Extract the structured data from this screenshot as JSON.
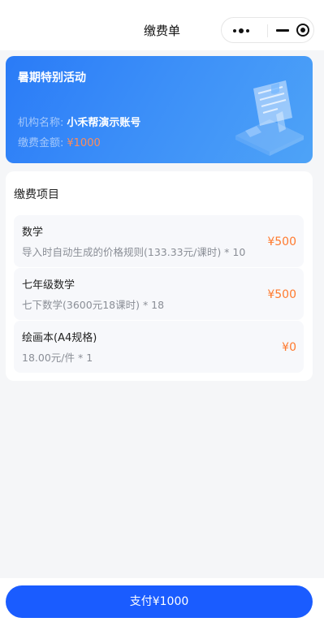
{
  "navbar": {
    "title": "缴费单",
    "more_icon": "more-dots-icon",
    "minimize_icon": "minimize-icon",
    "close_icon": "target-circle-icon"
  },
  "banner": {
    "title": "暑期特别活动",
    "org_label": "机构名称:",
    "org_value": "小禾帮演示账号",
    "amount_label": "缴费金额:",
    "amount_value": "¥1000",
    "illustration_icon": "bill-document-illustration"
  },
  "items_card": {
    "title": "缴费项目",
    "items": [
      {
        "name": "数学",
        "desc": "导入时自动生成的价格规则(133.33元/课时) * 10",
        "price": "¥500"
      },
      {
        "name": "七年级数学",
        "desc": "七下数学(3600元18课时) * 18",
        "price": "¥500"
      },
      {
        "name": "绘画本(A4规格)",
        "desc": "18.00元/件 * 1",
        "price": "¥0"
      }
    ]
  },
  "footer": {
    "pay_label": "支付¥1000"
  },
  "colors": {
    "primary": "#1a5cff",
    "price": "#ff7a2e",
    "banner_start": "#2a7bf7",
    "banner_end": "#4ea3f7"
  }
}
